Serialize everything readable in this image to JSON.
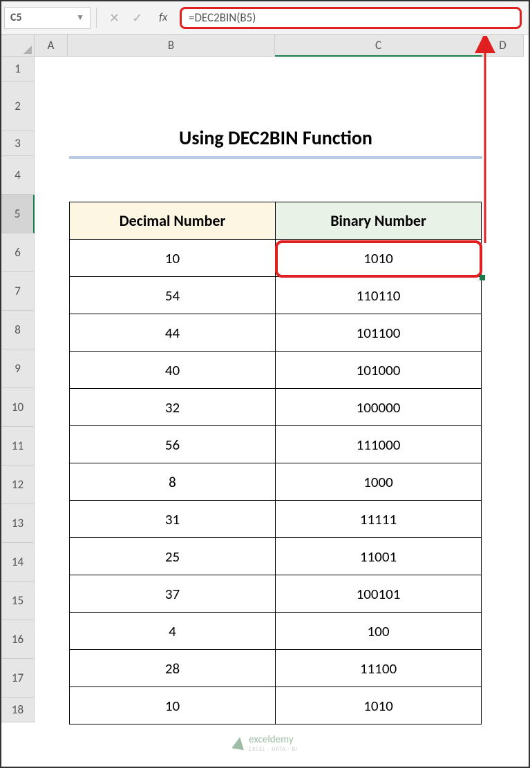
{
  "nameBox": "C5",
  "formula": "=DEC2BIN(B5)",
  "fxLabel": "fx",
  "columns": {
    "A": "A",
    "B": "B",
    "C": "C",
    "D": "D"
  },
  "rowNumbers": [
    "1",
    "2",
    "3",
    "4",
    "5",
    "6",
    "7",
    "8",
    "9",
    "10",
    "11",
    "12",
    "13",
    "14",
    "15",
    "16",
    "17",
    "18"
  ],
  "title": "Using DEC2BIN Function",
  "headers": {
    "decimal": "Decimal Number",
    "binary": "Binary Number"
  },
  "rows": [
    {
      "dec": "10",
      "bin": "1010"
    },
    {
      "dec": "54",
      "bin": "110110"
    },
    {
      "dec": "44",
      "bin": "101100"
    },
    {
      "dec": "40",
      "bin": "101000"
    },
    {
      "dec": "32",
      "bin": "100000"
    },
    {
      "dec": "56",
      "bin": "111000"
    },
    {
      "dec": "8",
      "bin": "1000"
    },
    {
      "dec": "31",
      "bin": "11111"
    },
    {
      "dec": "25",
      "bin": "11001"
    },
    {
      "dec": "37",
      "bin": "100101"
    },
    {
      "dec": "4",
      "bin": "100"
    },
    {
      "dec": "28",
      "bin": "11100"
    },
    {
      "dec": "10",
      "bin": "1010"
    }
  ],
  "watermark": {
    "brand": "exceldemy",
    "sub": "EXCEL · DATA · BI"
  },
  "chart_data": {
    "type": "table",
    "title": "Using DEC2BIN Function",
    "columns": [
      "Decimal Number",
      "Binary Number"
    ],
    "rows": [
      [
        10,
        "1010"
      ],
      [
        54,
        "110110"
      ],
      [
        44,
        "101100"
      ],
      [
        40,
        "101000"
      ],
      [
        32,
        "100000"
      ],
      [
        56,
        "111000"
      ],
      [
        8,
        "1000"
      ],
      [
        31,
        "11111"
      ],
      [
        25,
        "11001"
      ],
      [
        37,
        "100101"
      ],
      [
        4,
        "100"
      ],
      [
        28,
        "11100"
      ],
      [
        10,
        "1010"
      ]
    ]
  }
}
